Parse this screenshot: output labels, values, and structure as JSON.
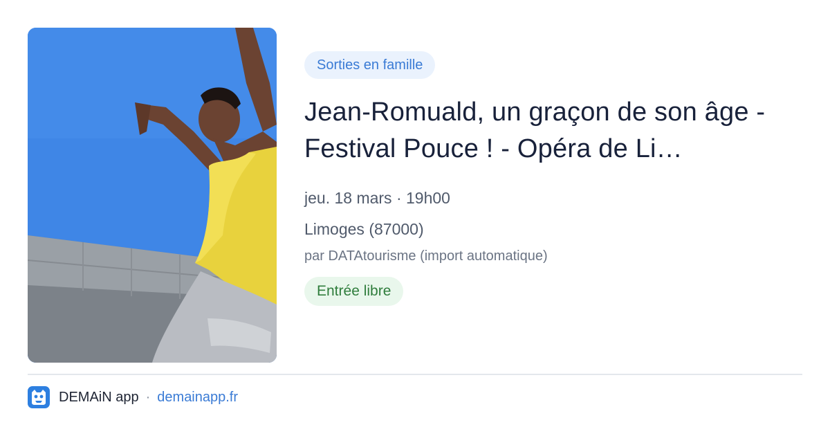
{
  "event": {
    "category": "Sorties en famille",
    "title": "Jean-Romuald, un graçon de son âge - Festival Pouce ! - Opéra de Li…",
    "date": "jeu. 18 mars · 19h00",
    "location": "Limoges (87000)",
    "source": "par DATAtourisme (import automatique)",
    "price": "Entrée libre"
  },
  "footer": {
    "app_name": "DEMAiN app",
    "separator": "·",
    "domain": "demainapp.fr"
  },
  "icons": {
    "logo": "demain-app-logo-icon"
  },
  "colors": {
    "accent": "#3a7bd5",
    "category_chip_bg": "#eaf2fd",
    "price_chip_bg": "#e9f7ec",
    "price_text": "#2f7d3c"
  }
}
